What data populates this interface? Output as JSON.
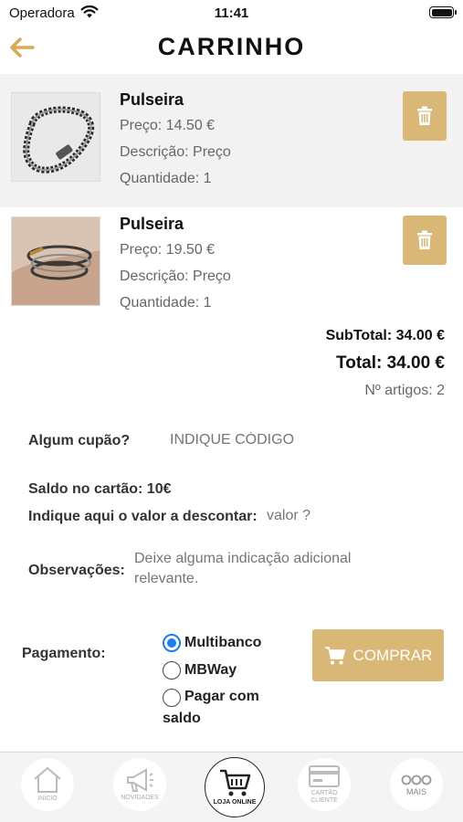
{
  "statusbar": {
    "carrier": "Operadora",
    "time": "11:41"
  },
  "header": {
    "title": "CARRINHO",
    "back_icon": "arrow-left-icon"
  },
  "items": [
    {
      "name": "Pulseira",
      "price": "Preço: 14.50 €",
      "description": "Descrição: Preço",
      "quantity": "Quantidade: 1"
    },
    {
      "name": "Pulseira",
      "price": "Preço: 19.50 €",
      "description": "Descrição: Preço",
      "quantity": "Quantidade: 1"
    }
  ],
  "totals": {
    "subtotal": "SubTotal: 34.00 €",
    "total": "Total: 34.00 €",
    "count": "Nº artigos: 2"
  },
  "coupon": {
    "label": "Algum cupão?",
    "placeholder": "INDIQUE CÓDIGO"
  },
  "balance": {
    "label": "Saldo no cartão: 10€",
    "discount_label": "Indique aqui o valor a descontar:",
    "discount_placeholder": "valor ?"
  },
  "notes": {
    "label": "Observações:",
    "placeholder": "Deixe alguma indicação adicional relevante."
  },
  "payment": {
    "label": "Pagamento:",
    "options": [
      "Multibanco",
      "MBWay",
      "Pagar com saldo"
    ],
    "selected": "Multibanco"
  },
  "buy_button": {
    "label": "COMPRAR"
  },
  "tabbar": {
    "tabs": [
      {
        "label": "INÍCIO",
        "icon": "home-icon"
      },
      {
        "label": "NOVIDADES",
        "icon": "megaphone-icon"
      },
      {
        "label": "LOJA ONLINE",
        "icon": "cart-icon"
      },
      {
        "label": "CARTÃO CLIENTE",
        "icon": "card-icon"
      },
      {
        "label": "MAIS",
        "icon": "more-icon"
      }
    ]
  },
  "colors": {
    "accent": "#d9b776",
    "radio_selected": "#1a7df2"
  }
}
